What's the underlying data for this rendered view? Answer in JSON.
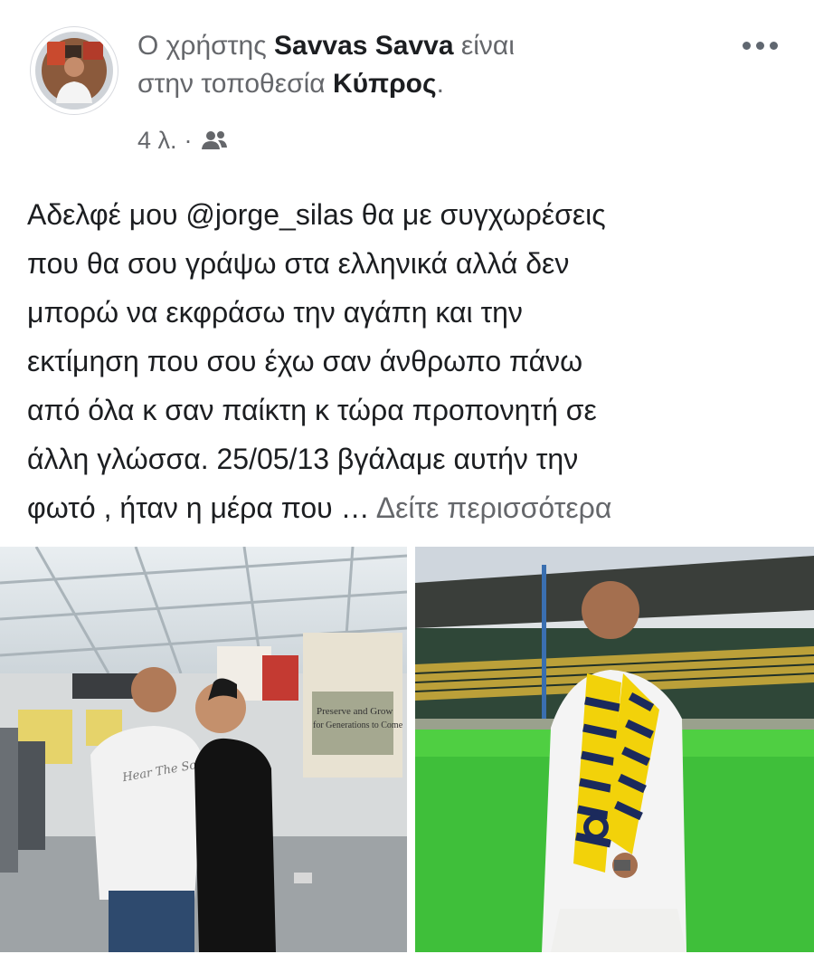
{
  "post": {
    "author_prefix": "Ο χρήστης",
    "author_name": "Savvas Savva",
    "location_connector": "είναι",
    "location_prefix": "στην τοποθεσία",
    "location_name": "Κύπρος",
    "location_suffix": ".",
    "time": "4 λ.",
    "meta_separator": "·",
    "audience_icon": "friends-icon",
    "more_icon": "more-options-icon",
    "text_lines": [
      "Αδελφέ μου @jorge_silas θα με συγχωρέσεις",
      "που θα σου γράψω στα ελληνικά αλλά δεν",
      "μπορώ να εκφράσω την αγάπη και την",
      "εκτίμηση που σου έχω σαν άνθρωπο πάνω",
      "από όλα κ σαν παίκτη κ τώρα προπονητή σε",
      "άλλη γλώσσα. 25/05/13 βγάλαμε αυτήν την",
      "φωτό , ήταν η μέρα που …"
    ],
    "see_more": "Δείτε περισσότερα"
  },
  "photos": {
    "left": {
      "sign_1": "Preserve and Grow",
      "sign_2": "for Generations to Come",
      "shirt_text": "Hear The Sound"
    }
  },
  "colors": {
    "text_primary": "#1c1e21",
    "text_secondary": "#65676b",
    "scarf_yellow": "#f2d20a",
    "scarf_navy": "#1b2a5c"
  }
}
